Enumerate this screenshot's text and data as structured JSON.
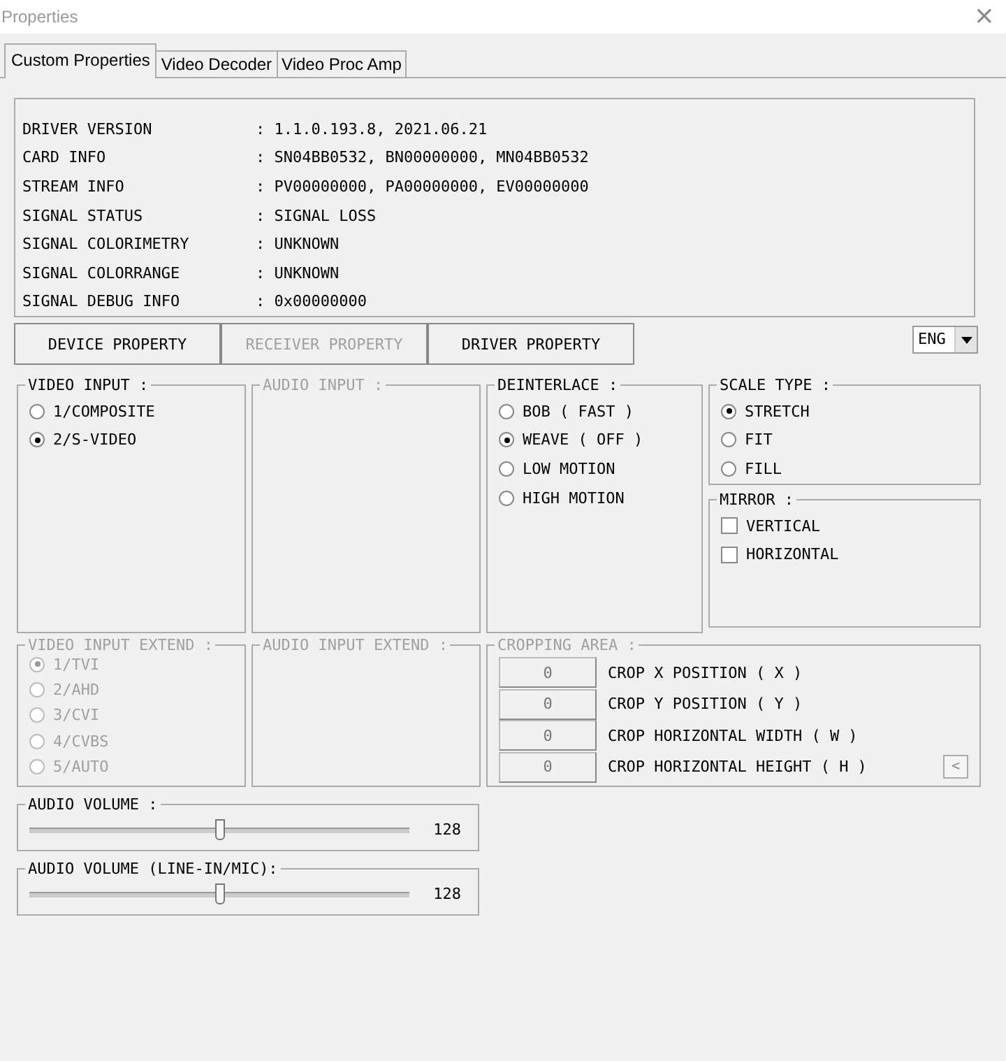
{
  "window": {
    "title": "Properties",
    "close": "×"
  },
  "tabs": [
    {
      "label": "Custom Properties",
      "selected": true
    },
    {
      "label": "Video Decoder",
      "selected": false
    },
    {
      "label": "Video Proc Amp",
      "selected": false
    }
  ],
  "info": [
    {
      "label": "DRIVER VERSION",
      "value": ": 1.1.0.193.8, 2021.06.21"
    },
    {
      "label": "CARD INFO",
      "value": ": SN04BB0532, BN00000000, MN04BB0532"
    },
    {
      "label": "STREAM INFO",
      "value": ": PV00000000, PA00000000, EV00000000"
    },
    {
      "label": "SIGNAL STATUS",
      "value": ": SIGNAL LOSS"
    },
    {
      "label": "SIGNAL COLORIMETRY",
      "value": ": UNKNOWN"
    },
    {
      "label": "SIGNAL COLORRANGE",
      "value": ": UNKNOWN"
    },
    {
      "label": "SIGNAL DEBUG INFO",
      "value": ": 0x00000000"
    }
  ],
  "mode_buttons": [
    {
      "label": "DEVICE PROPERTY",
      "disabled": false
    },
    {
      "label": "RECEIVER PROPERTY",
      "disabled": true
    },
    {
      "label": "DRIVER PROPERTY",
      "disabled": false
    }
  ],
  "language": {
    "value": "ENG"
  },
  "video_input": {
    "title": "VIDEO INPUT :",
    "disabled": false,
    "options": [
      {
        "label": "1/COMPOSITE",
        "selected": false
      },
      {
        "label": "2/S-VIDEO",
        "selected": true
      }
    ]
  },
  "audio_input": {
    "title": "AUDIO INPUT :",
    "disabled": true
  },
  "deinterlace": {
    "title": "DEINTERLACE :",
    "disabled": false,
    "options": [
      {
        "label": "BOB ( FAST )",
        "selected": false
      },
      {
        "label": "WEAVE ( OFF )",
        "selected": true
      },
      {
        "label": "LOW MOTION",
        "selected": false
      },
      {
        "label": "HIGH MOTION",
        "selected": false
      }
    ]
  },
  "scale_type": {
    "title": "SCALE TYPE :",
    "disabled": false,
    "options": [
      {
        "label": "STRETCH",
        "selected": true
      },
      {
        "label": "FIT",
        "selected": false
      },
      {
        "label": "FILL",
        "selected": false
      }
    ]
  },
  "mirror": {
    "title": "MIRROR :",
    "disabled": false,
    "options": [
      {
        "label": "VERTICAL",
        "checked": false
      },
      {
        "label": "HORIZONTAL",
        "checked": false
      }
    ]
  },
  "video_input_extend": {
    "title": "VIDEO INPUT EXTEND :",
    "disabled": true,
    "options": [
      {
        "label": "1/TVI",
        "selected": true
      },
      {
        "label": "2/AHD",
        "selected": false
      },
      {
        "label": "3/CVI",
        "selected": false
      },
      {
        "label": "4/CVBS",
        "selected": false
      },
      {
        "label": "5/AUTO",
        "selected": false
      }
    ]
  },
  "audio_input_extend": {
    "title": "AUDIO INPUT EXTEND :",
    "disabled": true
  },
  "cropping_area": {
    "title": "CROPPING AREA :",
    "disabled": true,
    "rows": [
      {
        "value": "0",
        "label": "CROP X POSITION ( X )"
      },
      {
        "value": "0",
        "label": "CROP Y POSITION ( Y )"
      },
      {
        "value": "0",
        "label": "CROP HORIZONTAL WIDTH ( W )"
      },
      {
        "value": "0",
        "label": "CROP HORIZONTAL HEIGHT ( H )"
      }
    ],
    "button": "<"
  },
  "volumes": [
    {
      "title": "AUDIO VOLUME :",
      "level": 0.5,
      "reading": "128"
    },
    {
      "title": "AUDIO VOLUME (LINE-IN/MIC):",
      "level": 0.5,
      "reading": "128"
    }
  ]
}
